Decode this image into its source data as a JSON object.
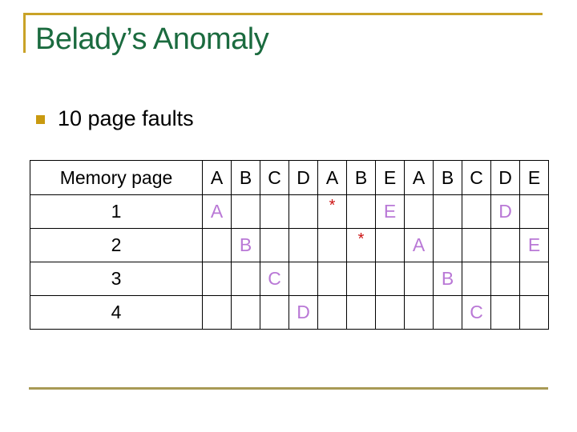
{
  "slide": {
    "title": "Belady’s Anomaly",
    "bullets": [
      "10 page faults"
    ]
  },
  "table": {
    "header_label": "Memory page",
    "reference_string": [
      "A",
      "B",
      "C",
      "D",
      "A",
      "B",
      "E",
      "A",
      "B",
      "C",
      "D",
      "E"
    ],
    "rows": [
      {
        "label": "1",
        "cells": [
          "A",
          "",
          "",
          "",
          "*",
          "",
          "E",
          "",
          "",
          "",
          "D",
          ""
        ]
      },
      {
        "label": "2",
        "cells": [
          "",
          "B",
          "",
          "",
          "",
          "*",
          "",
          "A",
          "",
          "",
          "",
          "E"
        ]
      },
      {
        "label": "3",
        "cells": [
          "",
          "",
          "C",
          "",
          "",
          "",
          "",
          "",
          "B",
          "",
          "",
          ""
        ]
      },
      {
        "label": "4",
        "cells": [
          "",
          "",
          "",
          "D",
          "",
          "",
          "",
          "",
          "",
          "C",
          "",
          ""
        ]
      }
    ]
  },
  "colors": {
    "title": "#1b6b3f",
    "accent_rule": "#c9a227",
    "page_loaded": "#b978d6",
    "hit_marker": "#cc1111"
  }
}
